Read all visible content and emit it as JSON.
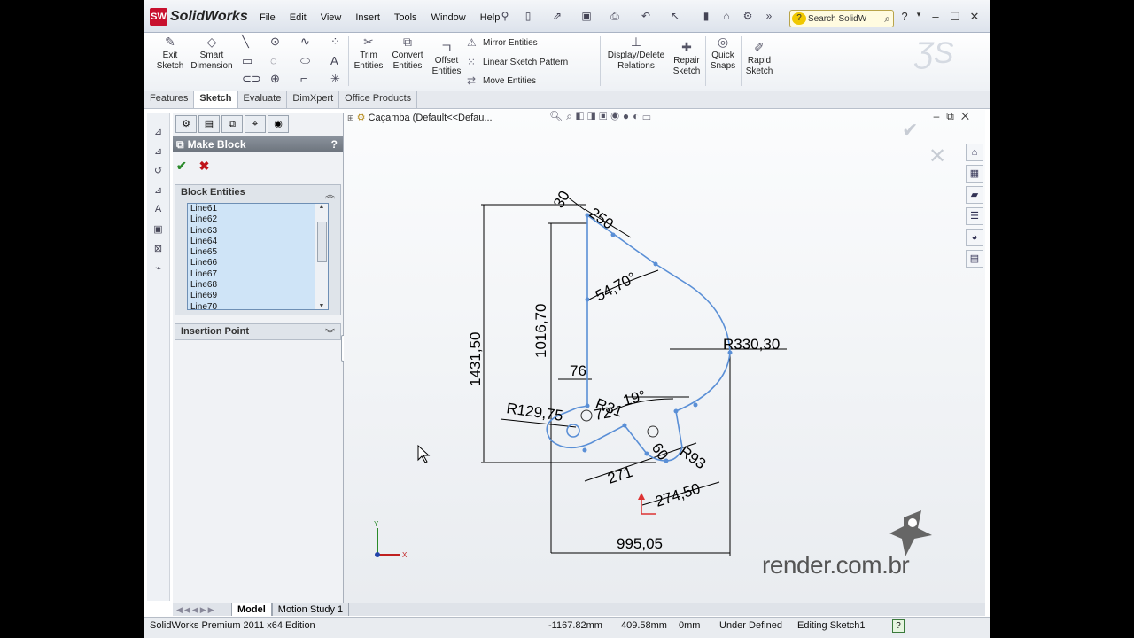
{
  "app": {
    "name": "SolidWorks",
    "logo_text": "SW"
  },
  "menu": [
    "File",
    "Edit",
    "View",
    "Insert",
    "Tools",
    "Window",
    "Help"
  ],
  "search_placeholder": "Search SolidW",
  "toolbar": {
    "exit_sketch": "Exit Sketch",
    "smart_dimension": "Smart Dimension",
    "trim_entities": "Trim Entities",
    "convert_entities": "Convert Entities",
    "offset_entities": "Offset Entities",
    "mirror_entities": "Mirror Entities",
    "linear_sketch_pattern": "Linear Sketch Pattern",
    "move_entities": "Move Entities",
    "display_delete_relations": "Display/Delete Relations",
    "repair_sketch": "Repair Sketch",
    "quick_snaps": "Quick Snaps",
    "rapid_sketch": "Rapid Sketch"
  },
  "tabs": [
    "Features",
    "Sketch",
    "Evaluate",
    "DimXpert",
    "Office Products"
  ],
  "active_tab": "Sketch",
  "property_manager": {
    "title": "Make Block",
    "help": "?",
    "ok": "✔",
    "cancel": "✖",
    "block_entities_label": "Block Entities",
    "block_entities": [
      "Line61",
      "Line62",
      "Line63",
      "Line64",
      "Line65",
      "Line66",
      "Line67",
      "Line68",
      "Line69",
      "Line70"
    ],
    "insertion_point_label": "Insertion Point"
  },
  "feature_tree": {
    "item": "Caçamba  (Default<<Defau..."
  },
  "dimensions": {
    "d30": "30",
    "d250": "250",
    "d1431": "1431,50",
    "d1016": "1016,70",
    "d5470": "54,70°",
    "r330": "R330,30",
    "d76": "76",
    "r12975": "R129,75",
    "r31": "R31",
    "d72": "72",
    "d19": "19°",
    "d60": "60",
    "r93": "R93",
    "d271": "271",
    "d27450": "274,50",
    "d99505": "995,05"
  },
  "watermark": {
    "text": "render.com.br"
  },
  "bottom_tabs": [
    "Model",
    "Motion Study 1"
  ],
  "active_bottom_tab": "Model",
  "status": {
    "edition": "SolidWorks Premium 2011 x64 Edition",
    "x": "-1167.82mm",
    "y": "409.58mm",
    "z": "0mm",
    "state": "Under Defined",
    "editing": "Editing Sketch1",
    "help": "?"
  },
  "colors": {
    "sketch": "#5a8fd6",
    "dimension": "#000000",
    "panel_header": "#7a8189",
    "accent_red": "#c8102e"
  }
}
